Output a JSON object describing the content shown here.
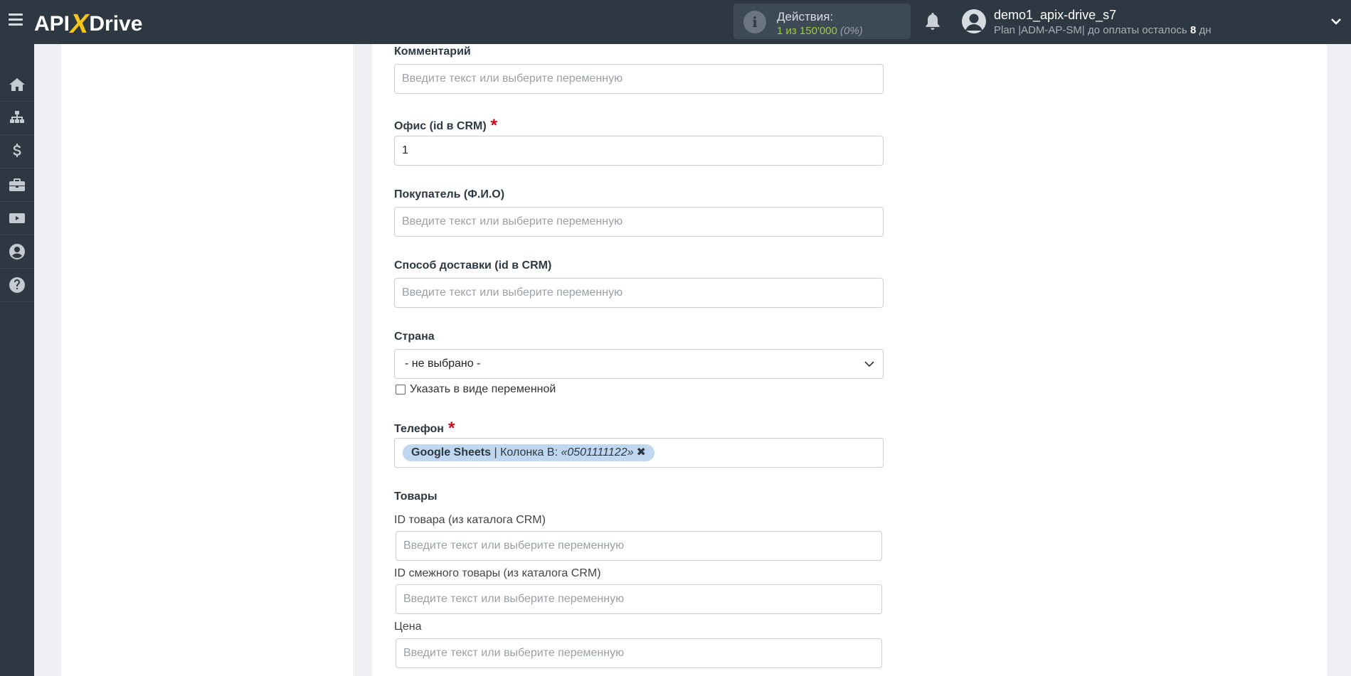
{
  "header": {
    "logo_api": "API",
    "logo_x": "X",
    "logo_drive": "Drive",
    "actions_title": "Действия:",
    "actions_used": "1 из 150'000",
    "actions_pct": "(0%)",
    "user_name": "demo1_apix-drive_s7",
    "plan_prefix": "Plan |ADM-AP-SM| до оплаты осталось ",
    "plan_days": "8",
    "plan_suffix": " дн"
  },
  "sidebar": {
    "items": [
      "home-icon",
      "sitemap-icon",
      "dollar-icon",
      "briefcase-icon",
      "youtube-icon",
      "user-circle-icon",
      "help-icon"
    ]
  },
  "form": {
    "comment_label": "Комментарий",
    "comment_placeholder": "Введите текст или выберите переменную",
    "office_label": "Офис (id в CRM)",
    "office_value": "1",
    "buyer_label": "Покупатель (Ф.И.О)",
    "buyer_placeholder": "Введите текст или выберите переменную",
    "delivery_label": "Способ доставки (id в CRM)",
    "delivery_placeholder": "Введите текст или выберите переменную",
    "country_label": "Страна",
    "country_value": "- не выбрано -",
    "as_variable_label": "Указать в виде переменной",
    "phone_label": "Телефон",
    "phone_tag_source": "Google Sheets",
    "phone_tag_column": " | Колонка B: ",
    "phone_tag_value": "«0501111122»",
    "phone_tag_remove": "✖",
    "required_mark": "*",
    "products_label": "Товары",
    "product_id_label": "ID товара (из каталога CRM)",
    "product_id_placeholder": "Введите текст или выберите переменную",
    "related_id_label": "ID смежного товары (из каталога CRM)",
    "related_id_placeholder": "Введите текст или выберите переменную",
    "price_label": "Цена",
    "price_placeholder": "Введите текст или выберите переменную"
  },
  "colors": {
    "header_bg": "#2e3842",
    "accent_green": "#9ccc3d",
    "logo_yellow": "#f5c518",
    "required_red": "#d0021b",
    "tag_bg": "#bfd7ef"
  }
}
